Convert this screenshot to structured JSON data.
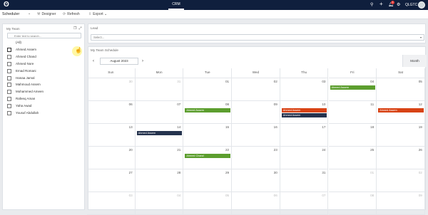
{
  "topbar": {
    "title": "CRM",
    "notification_count": "3",
    "org": "QLGTC",
    "icons": [
      "search-icon",
      "plus-icon",
      "bell-icon",
      "gear-icon"
    ]
  },
  "toolbar": {
    "app_name": "Scheduler",
    "designer": "Designer",
    "refresh": "Refresh",
    "export": "Export"
  },
  "team": {
    "title": "My Team",
    "search_placeholder": "Enter text to search...",
    "members": [
      "(All)",
      "Ahmed Assem",
      "Ahmed Chand",
      "Ahmed Nore",
      "Emad Romani",
      "Hanaa Jamal",
      "Mahmoud Assem",
      "Mohammed Ameen",
      "Rafeeq Aman",
      "Yaha Awad",
      "Yousuf Abdullah"
    ]
  },
  "lead": {
    "label": "Lead",
    "placeholder": "Select..."
  },
  "schedule": {
    "title": "My Team Schedule",
    "month_label": "August 2023",
    "view_button": "Month",
    "days": [
      "Sun",
      "Mon",
      "Tue",
      "Wed",
      "Thu",
      "Fri",
      "Sat"
    ],
    "weeks": [
      [
        "30",
        "31",
        "01",
        "02",
        "03",
        "04",
        "05"
      ],
      [
        "06",
        "07",
        "08",
        "09",
        "10",
        "11",
        "12"
      ],
      [
        "13",
        "14",
        "15",
        "16",
        "17",
        "18",
        "19"
      ],
      [
        "20",
        "21",
        "22",
        "23",
        "24",
        "25",
        "26"
      ],
      [
        "27",
        "28",
        "29",
        "30",
        "31",
        "01",
        "02"
      ],
      [
        "03",
        "04",
        "05",
        "06",
        "07",
        "08",
        "09"
      ]
    ],
    "events": [
      {
        "week": 0,
        "day": 5,
        "row": 0,
        "label": "Ahmed Assem",
        "color": "#5c9e2e"
      },
      {
        "week": 1,
        "day": 2,
        "row": 0,
        "label": "Ahmed Assem",
        "color": "#5c9e2e"
      },
      {
        "week": 1,
        "day": 4,
        "row": 0,
        "label": "Ahmed Assem",
        "color": "#d84315"
      },
      {
        "week": 1,
        "day": 4,
        "row": 1,
        "label": "Ahmed Assem",
        "color": "#25334e"
      },
      {
        "week": 1,
        "day": 6,
        "row": 0,
        "label": "Ahmed Assem",
        "color": "#d84315"
      },
      {
        "week": 2,
        "day": 1,
        "row": 0,
        "label": "Ahmed Assem",
        "color": "#25334e"
      },
      {
        "week": 3,
        "day": 2,
        "row": 0,
        "label": "Ahmed Chand",
        "color": "#5c9e2e"
      }
    ]
  }
}
